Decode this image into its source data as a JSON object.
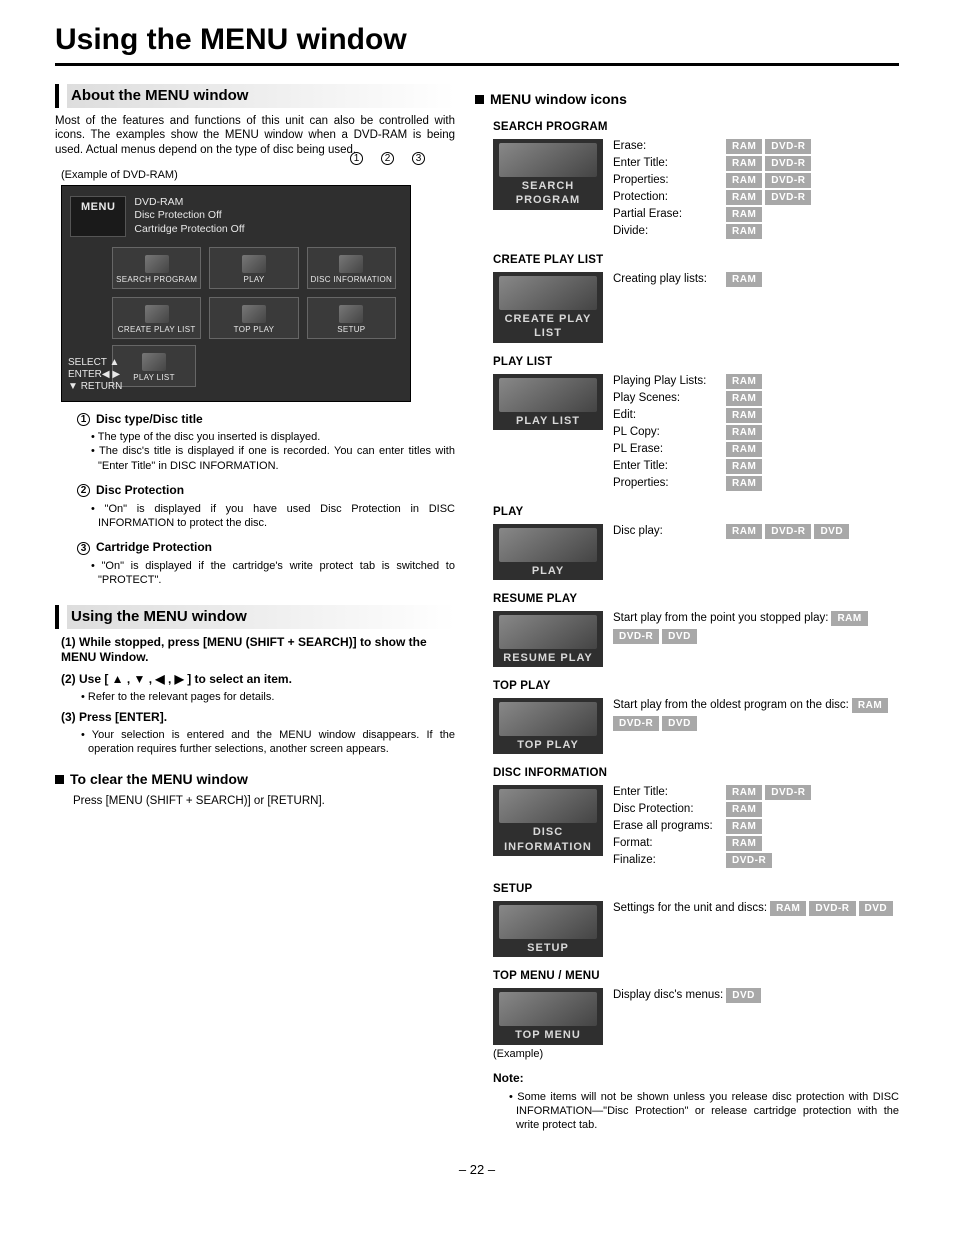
{
  "page_title": "Using the MENU window",
  "page_number": "– 22 –",
  "left": {
    "about_header": "About the MENU window",
    "about_text": "Most of the features and functions of this unit can also be controlled with icons. The examples show the MENU window when a DVD-RAM is being used. Actual menus depend on the type of disc being used.",
    "example_label": "(Example of DVD-RAM)",
    "menu_label": "MENU",
    "menu_info_1": "DVD-RAM",
    "menu_info_2": "Disc Protection   Off",
    "menu_info_3": "Cartridge Protection   Off",
    "tiles": [
      "SEARCH PROGRAM",
      "PLAY",
      "DISC INFORMATION",
      "CREATE PLAY LIST",
      "TOP PLAY",
      "SETUP",
      "PLAY LIST"
    ],
    "left_label_select": "SELECT",
    "left_label_enter": "ENTER",
    "left_label_return": "RETURN",
    "defs": [
      {
        "num": "1",
        "head": "Disc type/Disc title",
        "bullets": [
          "The type of the disc you inserted is displayed.",
          "The disc's title is displayed if one is recorded. You can enter titles with \"Enter Title\" in DISC INFORMATION."
        ]
      },
      {
        "num": "2",
        "head": "Disc Protection",
        "bullets": [
          "\"On\" is displayed if you have used Disc Protection in DISC INFORMATION to protect the disc."
        ]
      },
      {
        "num": "3",
        "head": "Cartridge Protection",
        "bullets": [
          "\"On\" is displayed if the cartridge's write protect tab is switched to \"PROTECT\"."
        ]
      }
    ],
    "using_header": "Using the MENU window",
    "steps": [
      {
        "step": "(1) While stopped, press [MENU (SHIFT + SEARCH)] to show the MENU Window.",
        "sub": []
      },
      {
        "step": "(2) Use [ ▲ , ▼ , ◀ , ▶ ] to select an item.",
        "sub": [
          "Refer to the relevant pages for details."
        ]
      },
      {
        "step": "(3) Press [ENTER].",
        "sub": [
          "Your selection is entered and the MENU window disappears. If the operation requires further selections, another screen appears."
        ]
      }
    ],
    "clear_header": "To clear the MENU window",
    "clear_text": "Press [MENU (SHIFT + SEARCH)] or [RETURN]."
  },
  "right": {
    "header": "MENU window icons",
    "groups": [
      {
        "title": "SEARCH PROGRAM",
        "thumb": "SEARCH PROGRAM",
        "lines": [
          {
            "label": "Erase:",
            "badges": [
              "RAM",
              "DVD-R"
            ]
          },
          {
            "label": "Enter Title:",
            "badges": [
              "RAM",
              "DVD-R"
            ]
          },
          {
            "label": "Properties:",
            "badges": [
              "RAM",
              "DVD-R"
            ]
          },
          {
            "label": "Protection:",
            "badges": [
              "RAM",
              "DVD-R"
            ]
          },
          {
            "label": "Partial Erase:",
            "badges": [
              "RAM"
            ]
          },
          {
            "label": "Divide:",
            "badges": [
              "RAM"
            ]
          }
        ]
      },
      {
        "title": "CREATE PLAY LIST",
        "thumb": "CREATE PLAY LIST",
        "lines": [
          {
            "label": "Creating play lists:",
            "badges": [
              "RAM"
            ]
          }
        ]
      },
      {
        "title": "PLAY LIST",
        "thumb": "PLAY LIST",
        "lines": [
          {
            "label": "Playing Play Lists:",
            "badges": [
              "RAM"
            ]
          },
          {
            "label": "Play Scenes:",
            "badges": [
              "RAM"
            ]
          },
          {
            "label": "Edit:",
            "badges": [
              "RAM"
            ]
          },
          {
            "label": "PL Copy:",
            "badges": [
              "RAM"
            ]
          },
          {
            "label": "PL Erase:",
            "badges": [
              "RAM"
            ]
          },
          {
            "label": "Enter Title:",
            "badges": [
              "RAM"
            ]
          },
          {
            "label": "Properties:",
            "badges": [
              "RAM"
            ]
          }
        ]
      },
      {
        "title": "PLAY",
        "thumb": "PLAY",
        "lines": [
          {
            "label": "Disc play:",
            "badges": [
              "RAM",
              "DVD-R",
              "DVD"
            ]
          }
        ]
      },
      {
        "title": "RESUME PLAY",
        "thumb": "RESUME PLAY",
        "lines": [
          {
            "label": "Start play from the point you stopped play:",
            "badges": [
              "RAM",
              "DVD-R",
              "DVD"
            ]
          }
        ]
      },
      {
        "title": "TOP PLAY",
        "thumb": "TOP PLAY",
        "lines": [
          {
            "label": "Start play from the oldest program on the disc:",
            "badges": [
              "RAM",
              "DVD-R",
              "DVD"
            ]
          }
        ]
      },
      {
        "title": "DISC INFORMATION",
        "thumb": "DISC INFORMATION",
        "lines": [
          {
            "label": "Enter Title:",
            "badges": [
              "RAM",
              "DVD-R"
            ]
          },
          {
            "label": "Disc Protection:",
            "badges": [
              "RAM"
            ]
          },
          {
            "label": "Erase all programs:",
            "badges": [
              "RAM"
            ]
          },
          {
            "label": "Format:",
            "badges": [
              "RAM"
            ]
          },
          {
            "label": "Finalize:",
            "badges": [
              "DVD-R"
            ]
          }
        ]
      },
      {
        "title": "SETUP",
        "thumb": "SETUP",
        "lines": [
          {
            "label": "Settings for the unit and discs:",
            "badges": [
              "RAM",
              "DVD-R",
              "DVD"
            ]
          }
        ]
      },
      {
        "title": "TOP MENU / MENU",
        "thumb": "TOP MENU",
        "example": "(Example)",
        "lines": [
          {
            "label": "Display disc's menus:",
            "badges": [
              "DVD"
            ]
          }
        ]
      }
    ],
    "note_head": "Note:",
    "note_body": "Some items will not be shown unless you release disc protection with DISC INFORMATION—\"Disc Protection\" or release cartridge protection with the write protect tab."
  }
}
